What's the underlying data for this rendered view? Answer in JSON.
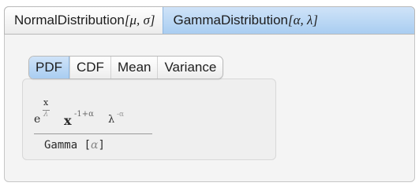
{
  "outer_tabs": {
    "normal": {
      "name": "NormalDistribution",
      "args": "[μ, σ]"
    },
    "gamma": {
      "name": "GammaDistribution",
      "args": "[α, λ]"
    }
  },
  "inner_tabs": [
    "PDF",
    "CDF",
    "Mean",
    "Variance"
  ],
  "formula": {
    "e": "e",
    "exp_numerator": "x",
    "exp_denominator": "λ",
    "x": "x",
    "x_exponent": "-1+α",
    "lambda": "λ",
    "lambda_exponent": "-α",
    "denominator_fn": "Gamma",
    "denominator_open": " [",
    "denominator_arg": "α",
    "denominator_close": "]"
  }
}
